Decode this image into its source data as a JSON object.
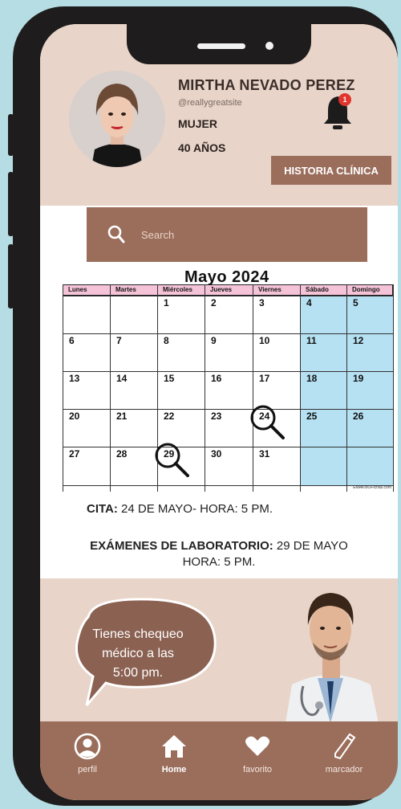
{
  "profile": {
    "name": "MIRTHA NEVADO PEREZ",
    "handle": "@reallygreatsite",
    "gender": "MUJER",
    "age": "40  AÑOS",
    "notification_count": "1",
    "history_button": "HISTORIA CLÍNICA"
  },
  "search": {
    "placeholder": "Search"
  },
  "calendar": {
    "title": "Mayo 2024",
    "weekdays": [
      "Lunes",
      "Martes",
      "Miércoles",
      "Jueves",
      "Viernes",
      "Sábado",
      "Domingo"
    ],
    "weeks": [
      [
        "",
        "",
        "1",
        "2",
        "3",
        "4",
        "5"
      ],
      [
        "6",
        "7",
        "8",
        "9",
        "10",
        "11",
        "12"
      ],
      [
        "13",
        "14",
        "15",
        "16",
        "17",
        "18",
        "19"
      ],
      [
        "20",
        "21",
        "22",
        "23",
        "24",
        "25",
        "26"
      ],
      [
        "27",
        "28",
        "29",
        "30",
        "31",
        "",
        ""
      ]
    ],
    "highlighted_days": [
      "24",
      "29"
    ],
    "weekend_color": "#b6e1f2",
    "header_color": "#f4c3d8",
    "watermark": "EMAKIoOFichas.com"
  },
  "appointment": {
    "label": "CITA:",
    "text": " 24 DE MAYO- HORA: 5 PM."
  },
  "exams": {
    "label": "EXÁMENES DE LABORATORIO:",
    "date": " 29 DE MAYO",
    "time": "HORA: 5 PM."
  },
  "reminder": {
    "line1": "Tienes chequeo",
    "line2": "médico a las",
    "line3": "5:00 pm."
  },
  "nav": {
    "items": [
      {
        "label": "perfil",
        "icon": "user-icon"
      },
      {
        "label": "Home",
        "icon": "home-icon"
      },
      {
        "label": "favorito",
        "icon": "heart-icon"
      },
      {
        "label": "marcador",
        "icon": "pencil-icon"
      }
    ]
  },
  "colors": {
    "accent": "#9b6e5c",
    "header_bg": "#e8d4c8",
    "page_bg": "#b5dde3",
    "phone_frame": "#1e1c1c",
    "badge": "#e0342c"
  }
}
